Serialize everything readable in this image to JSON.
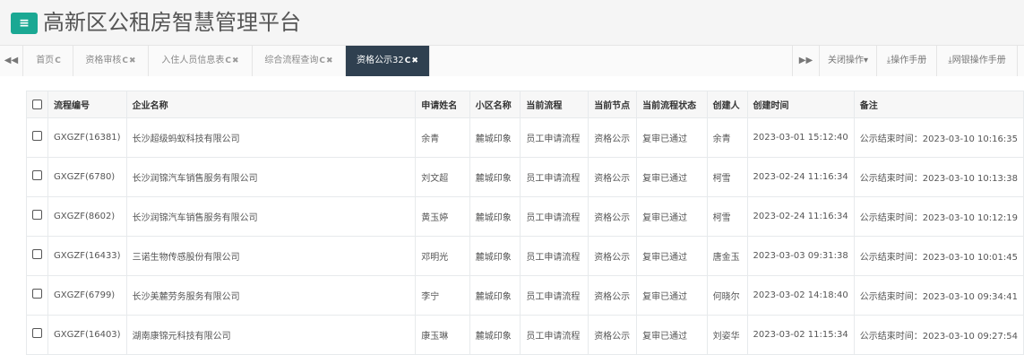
{
  "header": {
    "menu_icon": "bars-icon",
    "title": "高新区公租房智慧管理平台",
    "accent": "#1aa893"
  },
  "tabs": [
    {
      "label": "首页",
      "active": false
    },
    {
      "label": "资格审核",
      "active": false
    },
    {
      "label": "入住人员信息表",
      "active": false
    },
    {
      "label": "综合流程查询",
      "active": false
    },
    {
      "label": "资格公示32",
      "active": true
    }
  ],
  "tab_icons": {
    "refresh": "C",
    "close": "✖",
    "prev": "◀◀",
    "next": "▶▶"
  },
  "toolbar": {
    "close_ops": "关闭操作",
    "manual": "操作手册",
    "net_manual": "网银操作手册"
  },
  "table": {
    "columns": [
      "流程编号",
      "企业名称",
      "申请姓名",
      "小区名称",
      "当前流程",
      "当前节点",
      "当前流程状态",
      "创建人",
      "创建时间",
      "备注"
    ],
    "rows": [
      [
        "GXGZF(16381)",
        "长沙超级蚂蚁科技有限公司",
        "余青",
        "麓城印象",
        "员工申请流程",
        "资格公示",
        "复审已通过",
        "余青",
        "2023-03-01 15:12:40",
        "公示结束时间：2023-03-10 10:16:35"
      ],
      [
        "GXGZF(6780)",
        "长沙润锦汽车销售服务有限公司",
        "刘文超",
        "麓城印象",
        "员工申请流程",
        "资格公示",
        "复审已通过",
        "柯雪",
        "2023-02-24 11:16:34",
        "公示结束时间：2023-03-10 10:13:38"
      ],
      [
        "GXGZF(8602)",
        "长沙润锦汽车销售服务有限公司",
        "黄玉婷",
        "麓城印象",
        "员工申请流程",
        "资格公示",
        "复审已通过",
        "柯雪",
        "2023-02-24 11:16:34",
        "公示结束时间：2023-03-10 10:12:19"
      ],
      [
        "GXGZF(16433)",
        "三诺生物传感股份有限公司",
        "邓明光",
        "麓城印象",
        "员工申请流程",
        "资格公示",
        "复审已通过",
        "唐金玉",
        "2023-03-03 09:31:38",
        "公示结束时间：2023-03-10 10:01:45"
      ],
      [
        "GXGZF(6799)",
        "长沙美麓劳务服务有限公司",
        "李宁",
        "麓城印象",
        "员工申请流程",
        "资格公示",
        "复审已通过",
        "何晓尔",
        "2023-03-02 14:18:40",
        "公示结束时间：2023-03-10 09:34:41"
      ],
      [
        "GXGZF(16403)",
        "湖南康锦元科技有限公司",
        "康玉琳",
        "麓城印象",
        "员工申请流程",
        "资格公示",
        "复审已通过",
        "刘姿华",
        "2023-03-02 11:15:34",
        "公示结束时间：2023-03-10 09:27:54"
      ]
    ]
  }
}
